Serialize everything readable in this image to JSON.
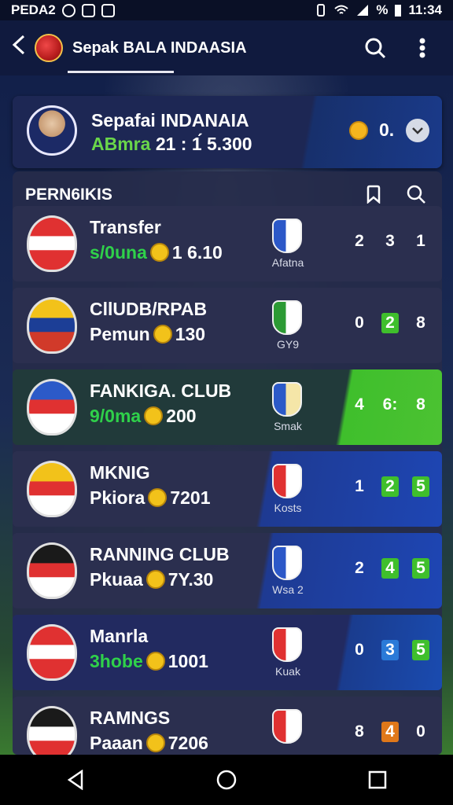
{
  "status_bar": {
    "left_text": "PEDA2",
    "time": "11:34",
    "battery": "%"
  },
  "app_bar": {
    "title": "Sepak BALA INDAASIA"
  },
  "hero": {
    "name": "Sepafai INDANAIA",
    "sub_prefix": "ABmra",
    "sub_value": "21 : 1́ 5.300",
    "score": "0."
  },
  "panel": {
    "heading": "PERN6IKIS"
  },
  "rows": [
    {
      "name": "Transfer",
      "sub_label": "s/0una",
      "sub_value": "1 6.10",
      "club_label": "Afatna",
      "scores": [
        "2",
        "3",
        "1"
      ],
      "score_styles": [
        "",
        "",
        ""
      ],
      "crest_colors": [
        "#e03131",
        "#ffffff",
        "#e03131"
      ],
      "club_colors": [
        "#2c58c8",
        "#ffffff"
      ],
      "style": "normal"
    },
    {
      "name": "CllUDB/RPAB",
      "sub_label": "Pemun",
      "sub_value": "130",
      "club_label": "GY9",
      "scores": [
        "0",
        "2",
        "8"
      ],
      "score_styles": [
        "",
        "green",
        ""
      ],
      "crest_colors": [
        "#f2c21a",
        "#1c3e96",
        "#d13a2a"
      ],
      "club_colors": [
        "#2c9a34",
        "#ffffff"
      ],
      "style": "normal"
    },
    {
      "name": "FANKIGA. CLUB",
      "sub_label": "9/0ma",
      "sub_value": "200",
      "club_label": "Smak",
      "scores": [
        "4",
        "6:",
        "8"
      ],
      "score_styles": [
        "",
        "",
        ""
      ],
      "crest_colors": [
        "#2c5ac8",
        "#e03131",
        "#ffffff"
      ],
      "club_colors": [
        "#2c5ac8",
        "#f5e6a8"
      ],
      "style": "hl-green"
    },
    {
      "name": "MKNIG",
      "sub_label": "Pkiora",
      "sub_value": "7201",
      "club_label": "Kosts",
      "scores": [
        "1",
        "2",
        "5"
      ],
      "score_styles": [
        "",
        "green",
        "green"
      ],
      "crest_colors": [
        "#f2c21a",
        "#e03131",
        "#ffffff"
      ],
      "club_colors": [
        "#e03131",
        "#ffffff"
      ],
      "style": "hl-blue"
    },
    {
      "name": "RANNING CLUB",
      "sub_label": "Pkuaa",
      "sub_value": "7Y.30",
      "club_label": "Wsa 2",
      "scores": [
        "2",
        "4",
        "5"
      ],
      "score_styles": [
        "",
        "green",
        "green"
      ],
      "crest_colors": [
        "#1a1a1a",
        "#e03131",
        "#ffffff"
      ],
      "club_colors": [
        "#2c58c8",
        "#ffffff"
      ],
      "style": "hl-blue"
    },
    {
      "name": "Manrla",
      "sub_label": "3hobe",
      "sub_value": "1001",
      "club_label": "Kuak",
      "scores": [
        "0",
        "3",
        "5"
      ],
      "score_styles": [
        "",
        "blue",
        "green"
      ],
      "crest_colors": [
        "#e03131",
        "#ffffff",
        "#e03131"
      ],
      "club_colors": [
        "#e03131",
        "#ffffff"
      ],
      "style": "hl-deep"
    },
    {
      "name": "RAMNGS",
      "sub_label": "Paaan",
      "sub_value": "7206",
      "club_label": "",
      "scores": [
        "8",
        "4",
        "0"
      ],
      "score_styles": [
        "",
        "orange",
        ""
      ],
      "crest_colors": [
        "#1a1a1a",
        "#ffffff",
        "#e03131"
      ],
      "club_colors": [
        "#e03131",
        "#ffffff"
      ],
      "style": "normal"
    }
  ]
}
